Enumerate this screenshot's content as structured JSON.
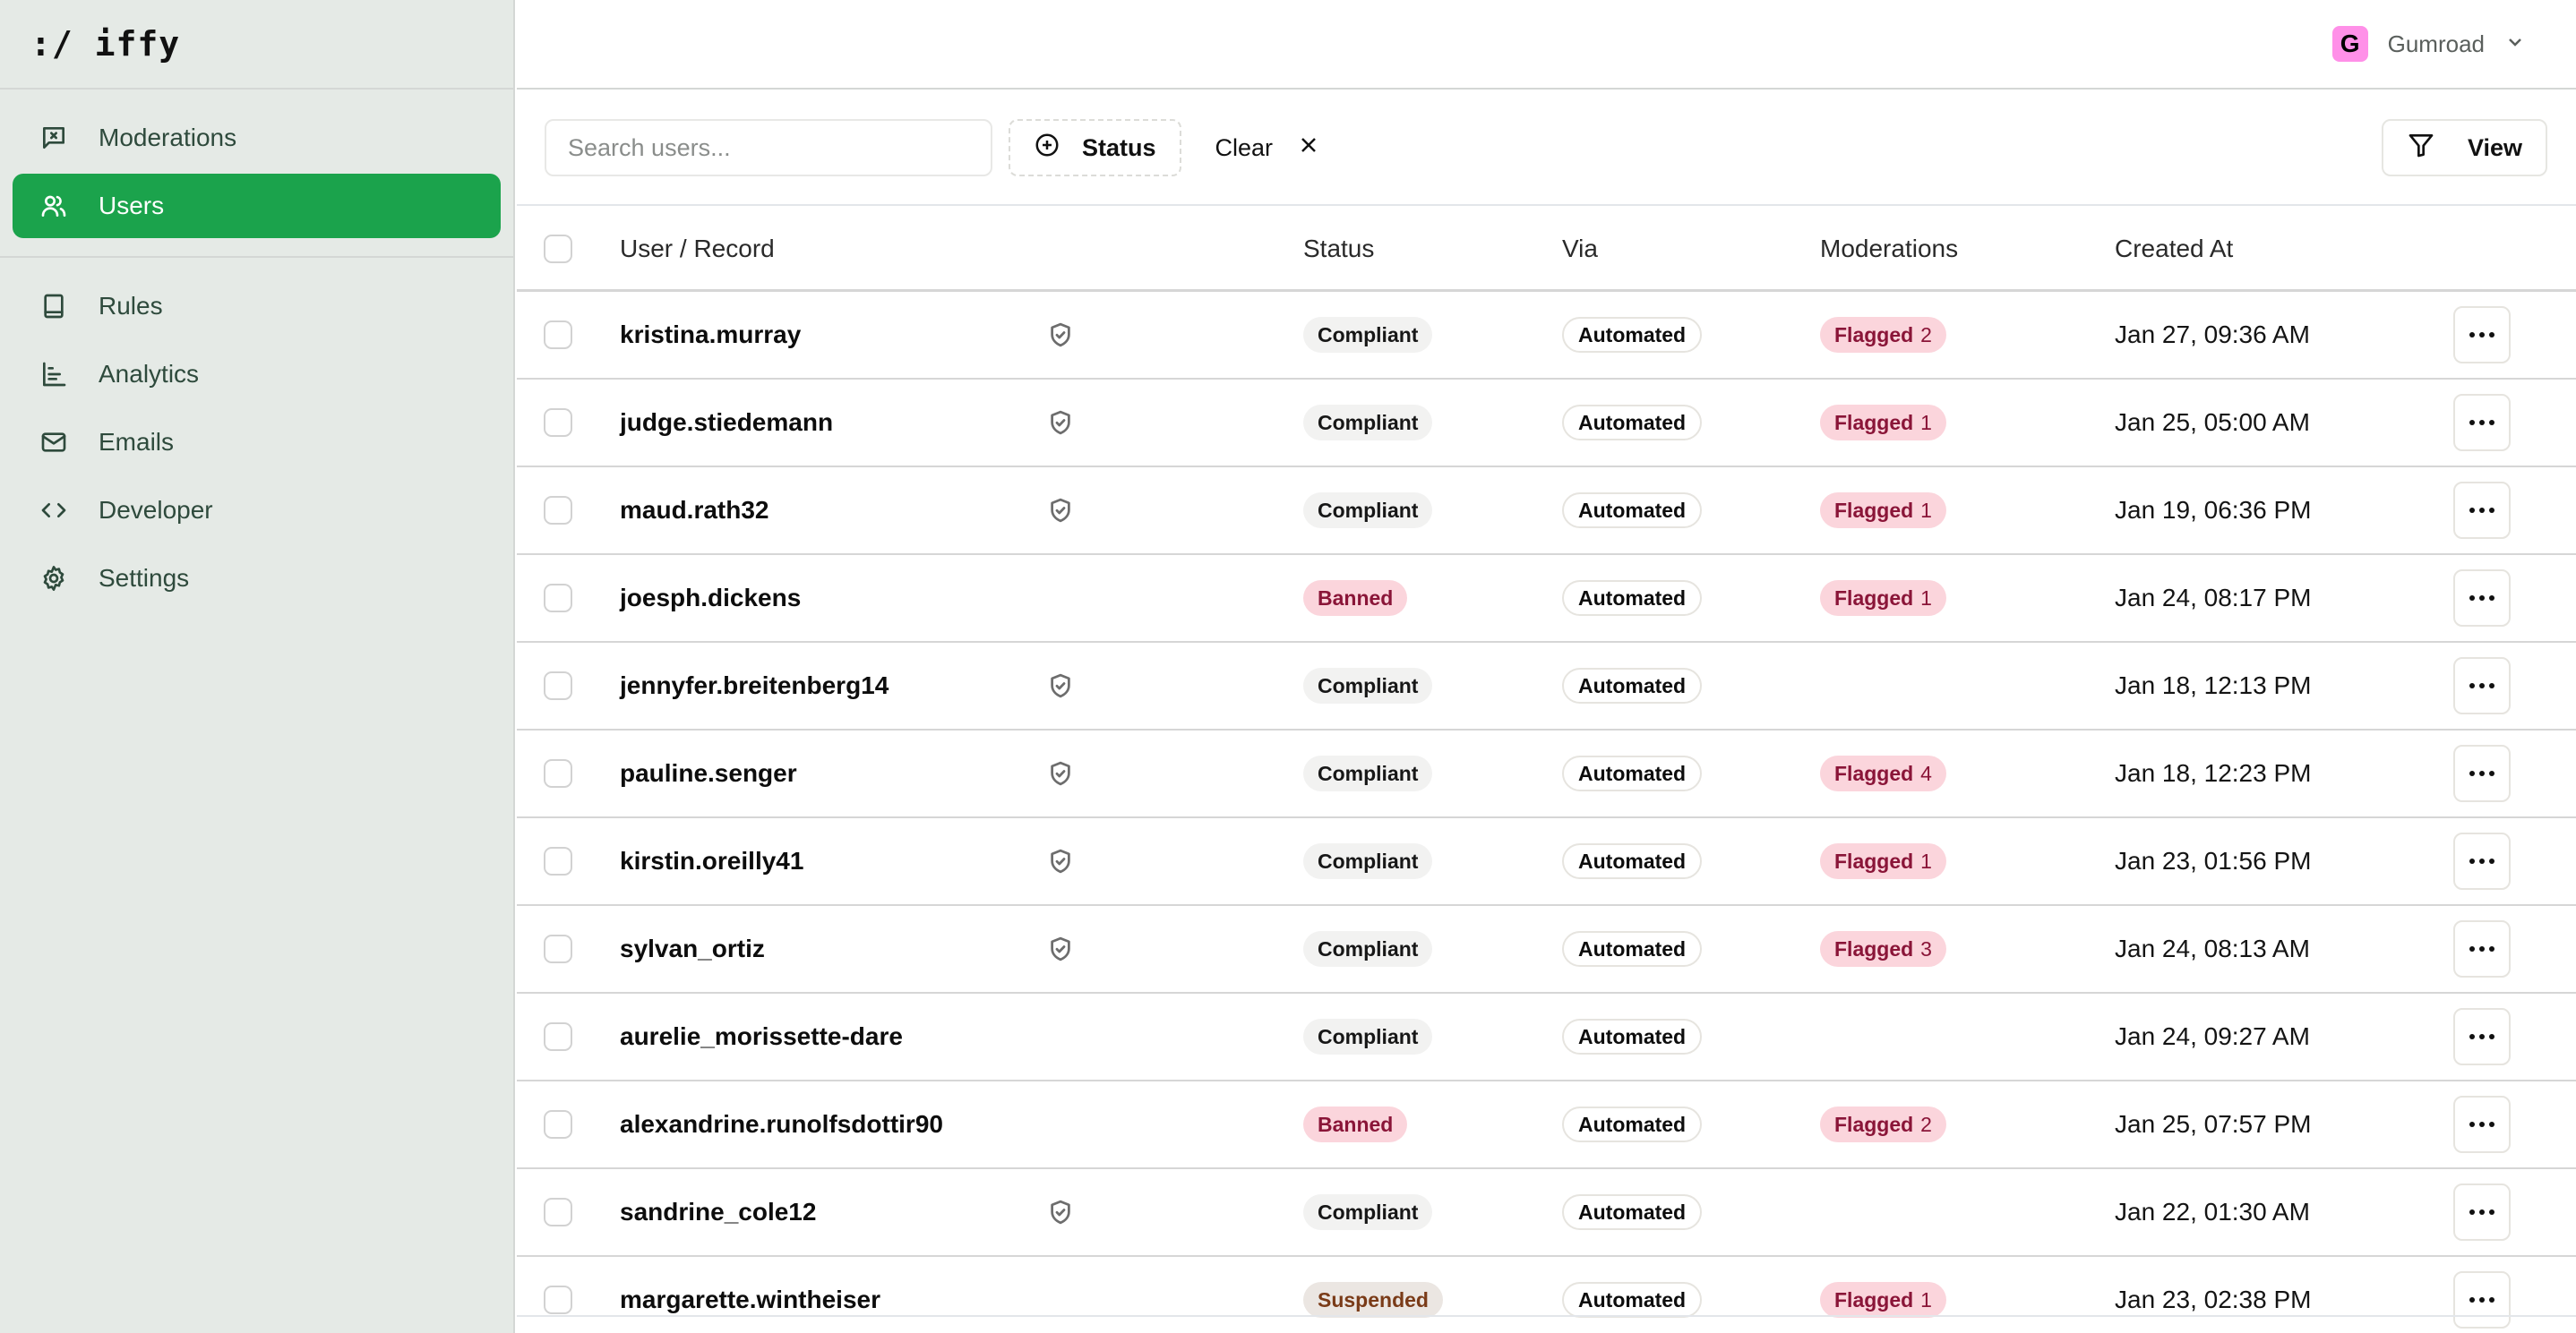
{
  "app": {
    "logo": ":/ iffy"
  },
  "sidebar": {
    "items": [
      {
        "label": "Moderations",
        "icon": "message-x-icon",
        "active": false
      },
      {
        "label": "Users",
        "icon": "users-icon",
        "active": true
      },
      {
        "label": "Rules",
        "icon": "book-icon",
        "active": false
      },
      {
        "label": "Analytics",
        "icon": "bar-chart-icon",
        "active": false
      },
      {
        "label": "Emails",
        "icon": "mail-icon",
        "active": false
      },
      {
        "label": "Developer",
        "icon": "code-icon",
        "active": false
      },
      {
        "label": "Settings",
        "icon": "gear-icon",
        "active": false
      }
    ]
  },
  "header": {
    "org_initial": "G",
    "org_name": "Gumroad",
    "org_color": "#ff90e8"
  },
  "toolbar": {
    "search_placeholder": "Search users...",
    "search_value": "",
    "status_filter_label": "Status",
    "clear_label": "Clear",
    "view_label": "View"
  },
  "table": {
    "columns": {
      "user": "User / Record",
      "status": "Status",
      "via": "Via",
      "moderations": "Moderations",
      "created_at": "Created At"
    },
    "rows": [
      {
        "user": "kristina.murray",
        "protected": true,
        "status": "Compliant",
        "via": "Automated",
        "flagged_label": "Flagged",
        "flagged_count": "2",
        "created_at": "Jan 27, 09:36 AM"
      },
      {
        "user": "judge.stiedemann",
        "protected": true,
        "status": "Compliant",
        "via": "Automated",
        "flagged_label": "Flagged",
        "flagged_count": "1",
        "created_at": "Jan 25, 05:00 AM"
      },
      {
        "user": "maud.rath32",
        "protected": true,
        "status": "Compliant",
        "via": "Automated",
        "flagged_label": "Flagged",
        "flagged_count": "1",
        "created_at": "Jan 19, 06:36 PM"
      },
      {
        "user": "joesph.dickens",
        "protected": false,
        "status": "Banned",
        "via": "Automated",
        "flagged_label": "Flagged",
        "flagged_count": "1",
        "created_at": "Jan 24, 08:17 PM"
      },
      {
        "user": "jennyfer.breitenberg14",
        "protected": true,
        "status": "Compliant",
        "via": "Automated",
        "flagged_label": null,
        "flagged_count": null,
        "created_at": "Jan 18, 12:13 PM"
      },
      {
        "user": "pauline.senger",
        "protected": true,
        "status": "Compliant",
        "via": "Automated",
        "flagged_label": "Flagged",
        "flagged_count": "4",
        "created_at": "Jan 18, 12:23 PM"
      },
      {
        "user": "kirstin.oreilly41",
        "protected": true,
        "status": "Compliant",
        "via": "Automated",
        "flagged_label": "Flagged",
        "flagged_count": "1",
        "created_at": "Jan 23, 01:56 PM"
      },
      {
        "user": "sylvan_ortiz",
        "protected": true,
        "status": "Compliant",
        "via": "Automated",
        "flagged_label": "Flagged",
        "flagged_count": "3",
        "created_at": "Jan 24, 08:13 AM"
      },
      {
        "user": "aurelie_morissette-dare",
        "protected": false,
        "status": "Compliant",
        "via": "Automated",
        "flagged_label": null,
        "flagged_count": null,
        "created_at": "Jan 24, 09:27 AM"
      },
      {
        "user": "alexandrine.runolfsdottir90",
        "protected": false,
        "status": "Banned",
        "via": "Automated",
        "flagged_label": "Flagged",
        "flagged_count": "2",
        "created_at": "Jan 25, 07:57 PM"
      },
      {
        "user": "sandrine_cole12",
        "protected": true,
        "status": "Compliant",
        "via": "Automated",
        "flagged_label": null,
        "flagged_count": null,
        "created_at": "Jan 22, 01:30 AM"
      },
      {
        "user": "margarette.wintheiser",
        "protected": false,
        "status": "Suspended",
        "via": "Automated",
        "flagged_label": "Flagged",
        "flagged_count": "1",
        "created_at": "Jan 23, 02:38 PM"
      }
    ]
  },
  "colors": {
    "accent": "#1ba34c",
    "sidebar_bg": "#e5eae6",
    "flagged_bg": "#fbd5dc",
    "flagged_text": "#8a1538",
    "suspended_text": "#7a3b18"
  }
}
